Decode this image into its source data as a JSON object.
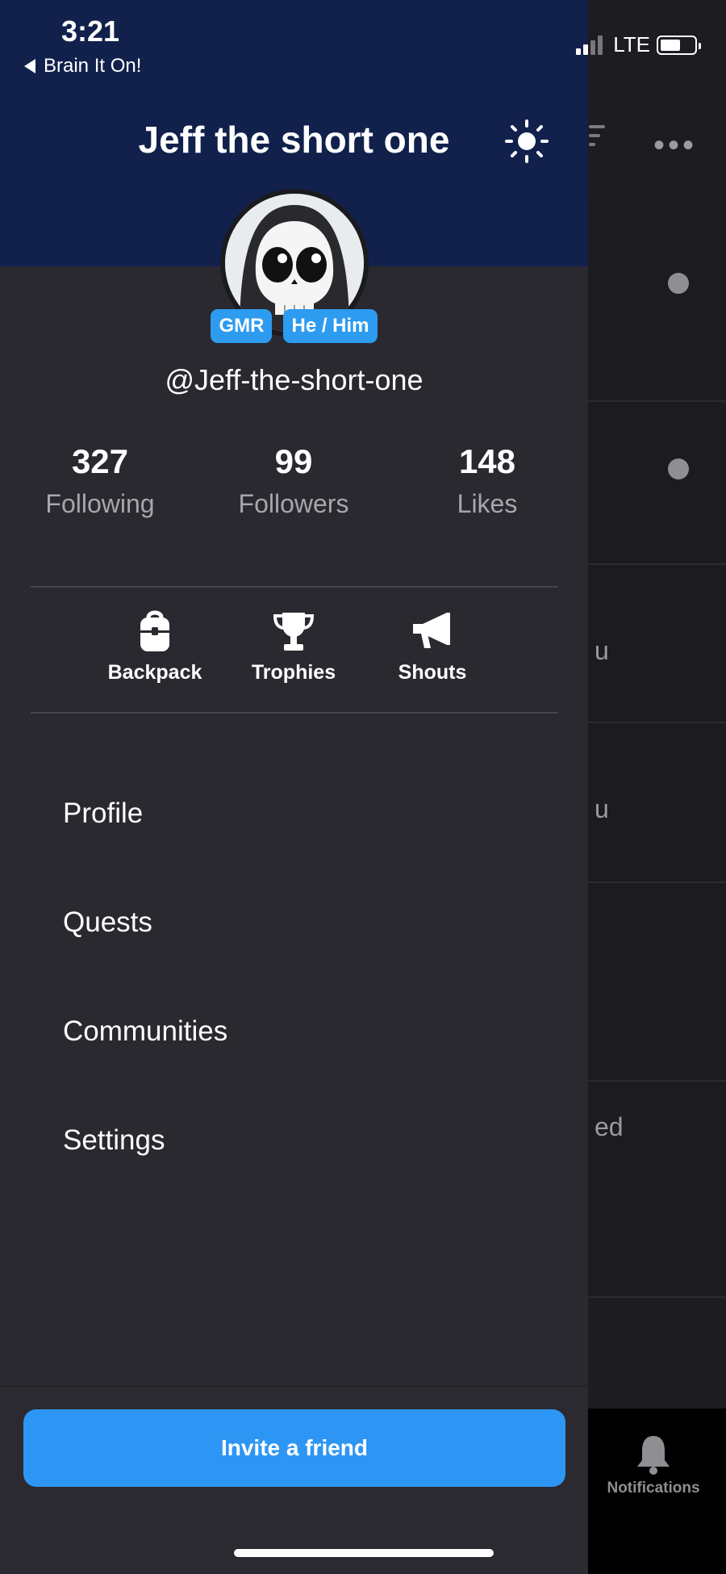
{
  "status_bar": {
    "time": "3:21",
    "back_app": "Brain It On!",
    "network": "LTE",
    "battery_percent": 60
  },
  "header": {
    "title": "Jeff the short one",
    "theme_toggle_icon": "sun-icon"
  },
  "profile": {
    "avatar_icon": "skull-reaper-avatar",
    "badges": [
      "GMR",
      "He / Him"
    ],
    "handle": "@Jeff-the-short-one"
  },
  "stats": [
    {
      "value": "327",
      "label": "Following"
    },
    {
      "value": "99",
      "label": "Followers"
    },
    {
      "value": "148",
      "label": "Likes"
    }
  ],
  "shortcuts": [
    {
      "label": "Backpack",
      "icon": "backpack-icon"
    },
    {
      "label": "Trophies",
      "icon": "trophy-icon"
    },
    {
      "label": "Shouts",
      "icon": "megaphone-icon"
    }
  ],
  "menu": [
    "Profile",
    "Quests",
    "Communities",
    "Settings"
  ],
  "footer": {
    "invite_label": "Invite a friend"
  },
  "background_app": {
    "fragments": [
      "u",
      "u",
      "ed"
    ],
    "tab_label": "Notifications",
    "more_icon": "more-horizontal-icon",
    "filter_icon": "filter-icon"
  },
  "colors": {
    "header_bg": "#11214b",
    "drawer_bg": "#29292f",
    "accent": "#2d96f5"
  }
}
